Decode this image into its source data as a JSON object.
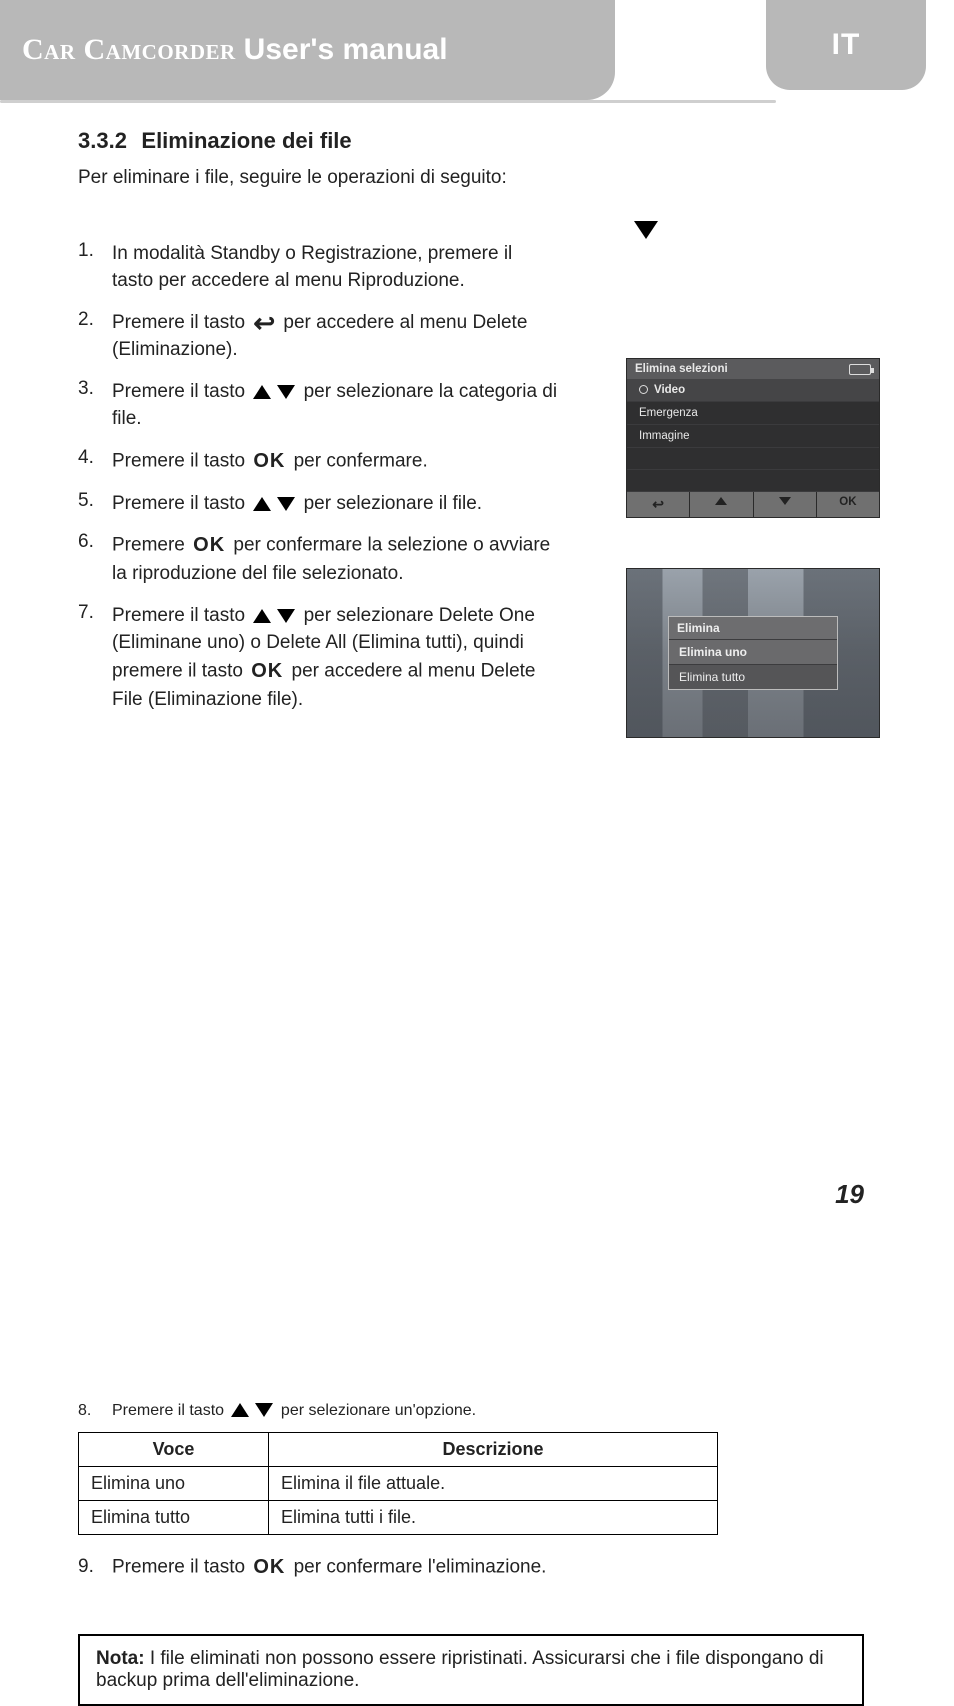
{
  "header": {
    "title_strong": "Car Camcorder",
    "title_light": "User's manual",
    "lang": "IT"
  },
  "section": {
    "number": "3.3.2",
    "title": "Eliminazione dei file"
  },
  "intro": "Per eliminare i file, seguire le operazioni di seguito:",
  "steps": [
    {
      "n": "1.",
      "pre": "In modalità Standby o Registrazione, premere il tasto ",
      "icon": "down",
      "post": " per accedere al menu Riproduzione."
    },
    {
      "n": "2.",
      "pre": "Premere il tasto ",
      "icon": "return",
      "post": " per accedere al menu Delete (Eliminazione)."
    },
    {
      "n": "3.",
      "pre": "Premere il tasto ",
      "icon": "updown",
      "post": " per selezionare la categoria di file."
    },
    {
      "n": "4.",
      "pre": "Premere il tasto ",
      "icon": "ok",
      "post": " per confermare."
    },
    {
      "n": "5.",
      "pre": "Premere il tasto ",
      "icon": "updown",
      "post": " per selezionare il file."
    },
    {
      "n": "6.",
      "pre": "Premere ",
      "icon": "ok",
      "post": " per confermare la selezione o avviare la riproduzione del file selezionato."
    },
    {
      "n": "7.",
      "pre": "Premere il tasto ",
      "icon": "updown",
      "post": " per selezionare Delete One (Eliminane uno) o Delete All (Elimina tutti), quindi premere il tasto ",
      "icon2": "ok",
      "post2": " per accedere al menu Delete File (Eliminazione file)."
    }
  ],
  "table_intro_pre": "Premere il tasto ",
  "table_intro_post": " per selezionare un'opzione.",
  "table": {
    "head": [
      "Voce",
      "Descrizione"
    ],
    "rows": [
      [
        "Elimina uno",
        "Elimina il file attuale."
      ],
      [
        "Elimina tutto",
        "Elimina tutti i file."
      ]
    ]
  },
  "after_table_pre": "Premere il tasto ",
  "after_table_post": " per confermare l'eliminazione.",
  "note": {
    "label": "Nota:",
    "text": "I file eliminati non possono essere ripristinati. Assicurarsi che i file dispongano di backup prima dell'eliminazione."
  },
  "page_number": "19",
  "screenshot1": {
    "title": "Elimina selezioni",
    "rows": [
      "Video",
      "Emergenza",
      "Immagine"
    ],
    "footer_ok": "OK"
  },
  "screenshot2": {
    "popup_title": "Elimina",
    "rows": [
      "Elimina uno",
      "Elimina tutto"
    ]
  }
}
